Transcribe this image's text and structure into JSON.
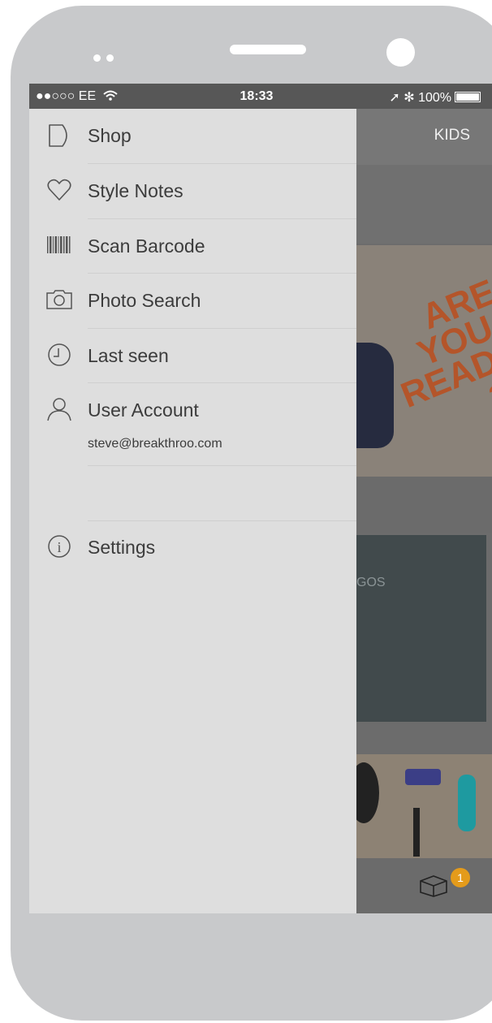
{
  "status_bar": {
    "carrier": "●●○○○ EE",
    "wifi_icon": "wifi-icon",
    "time": "18:33",
    "right": "➚ ✻ 100%"
  },
  "background": {
    "header_tab": "KIDS",
    "promo": {
      "line1": "ARE",
      "line2": "YOU",
      "line3": "READY",
      "line4": "?"
    },
    "teal_text": "GOS",
    "cart_count": "1"
  },
  "drawer": {
    "items": [
      {
        "label": "Shop",
        "icon": "play-outline-icon"
      },
      {
        "label": "Style Notes",
        "icon": "heart-outline-icon"
      },
      {
        "label": "Scan Barcode",
        "icon": "barcode-icon"
      },
      {
        "label": "Photo Search",
        "icon": "camera-icon"
      },
      {
        "label": "Last seen",
        "icon": "clock-icon"
      },
      {
        "label": "User Account",
        "icon": "user-icon",
        "sub": "steve@breakthroo.com"
      },
      {
        "label": "Settings",
        "icon": "info-circle-icon"
      }
    ]
  },
  "colors": {
    "phone": "#c8c9cb",
    "drawer": "#dedede",
    "badge": "#e49b1b",
    "promo_text": "#b4552a"
  }
}
